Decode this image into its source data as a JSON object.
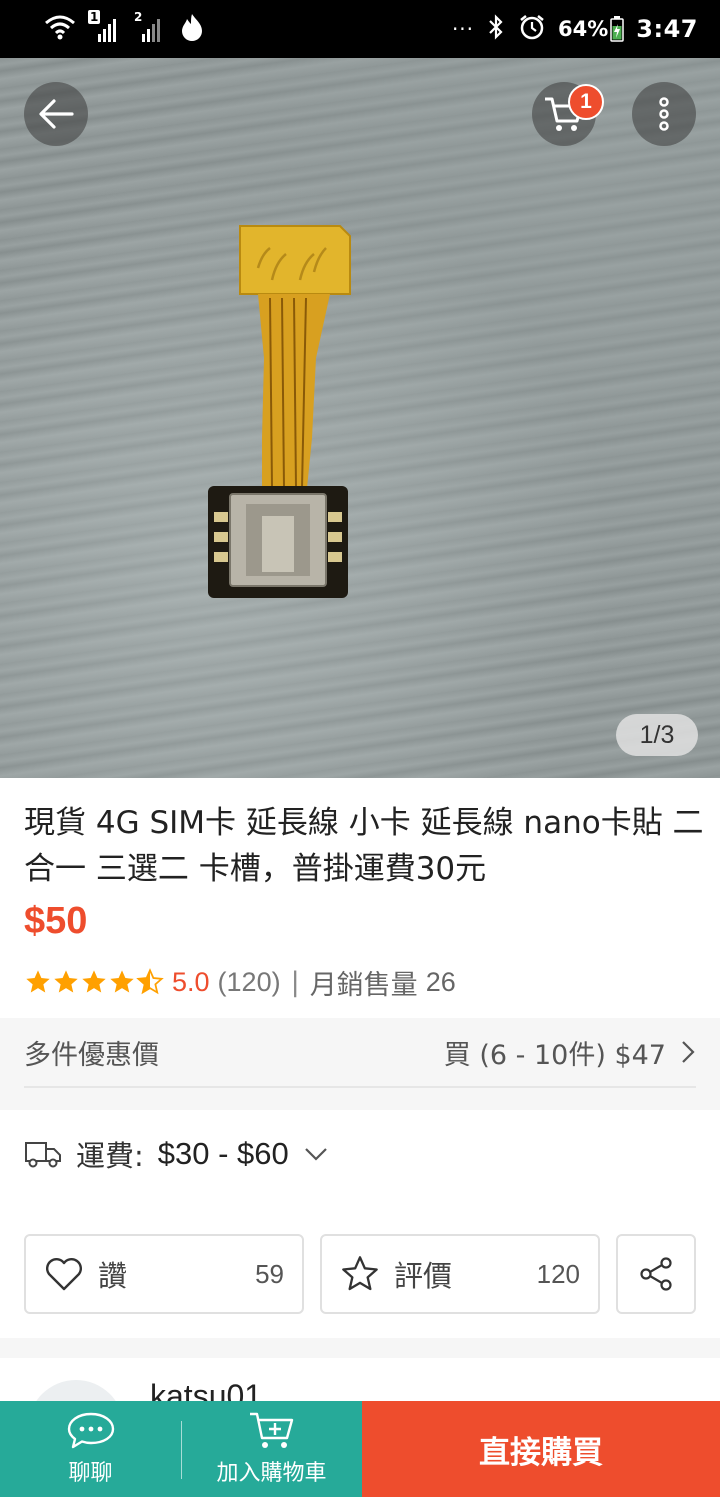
{
  "status_bar": {
    "battery": "64%",
    "time": "3:47",
    "sim1": "1",
    "sim2": "2",
    "more": "···"
  },
  "header": {
    "cart_badge": "1",
    "image_counter": "1/3"
  },
  "product": {
    "title": "現貨 4G SIM卡 延長線 小卡 延長線 nano卡貼 二合一 三選二 卡槽，普掛運費30元",
    "price": "$50",
    "rating_value": "5.0",
    "rating_count": "(120)",
    "rating_stars": 4.5,
    "separator": "|",
    "sold_label": "月銷售量",
    "sold_count": "26"
  },
  "bulk": {
    "label": "多件優惠價",
    "value": "買 (6 - 10件) $47"
  },
  "shipping": {
    "label": "運費:",
    "value": "$30 - $60"
  },
  "actions": {
    "like_label": "讚",
    "like_count": "59",
    "rate_label": "評價",
    "rate_count": "120"
  },
  "seller": {
    "name": "katsu01"
  },
  "bottom_bar": {
    "chat_label": "聊聊",
    "cart_label": "加入購物車",
    "buy_label": "直接購買"
  },
  "colors": {
    "accent": "#ee4d2d",
    "teal": "#26aa99",
    "star": "#ffa000"
  }
}
